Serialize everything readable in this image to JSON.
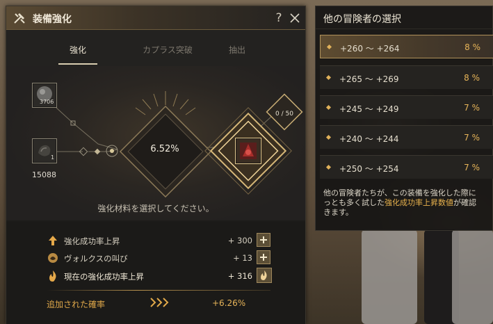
{
  "window": {
    "title": "装備強化",
    "help_label": "?"
  },
  "tabs": [
    {
      "label": "強化",
      "active": true
    },
    {
      "label": "カプラス突破",
      "active": false
    },
    {
      "label": "抽出",
      "active": false
    }
  ],
  "materials": {
    "stone": {
      "count_label": "15088",
      "slot_count": "3706"
    },
    "secondary": {
      "slot_count": "1"
    }
  },
  "success_rate": "6.52%",
  "cap_progress": "0 / 50",
  "instruction": "強化材料を選択してください。",
  "bonus_rows": [
    {
      "label": "強化成功率上昇",
      "value": "+ 300",
      "icon": "arrow-up-icon",
      "button": "plus"
    },
    {
      "label": "ヴォルクスの叫び",
      "value": "+ 13",
      "icon": "vorcus-icon",
      "button": "plus"
    },
    {
      "label": "現在の強化成功率上昇",
      "value": "+ 316",
      "icon": "flame-icon",
      "button": "flame"
    }
  ],
  "added": {
    "label": "追加された確率",
    "value": "+6.26%"
  },
  "side_panel": {
    "title": "他の冒険者の選択",
    "choices": [
      {
        "range": "+260 ～ +264",
        "percent": "8 %",
        "selected": true
      },
      {
        "range": "+265 ～ +269",
        "percent": "8 %",
        "selected": false
      },
      {
        "range": "+245 ～ +249",
        "percent": "7 %",
        "selected": false
      },
      {
        "range": "+240 ～ +244",
        "percent": "7 %",
        "selected": false
      },
      {
        "range": "+250 ～ +254",
        "percent": "7 %",
        "selected": false
      }
    ],
    "desc_part1": "他の冒険者たちが、この装備を強化した際に",
    "desc_part2": "っとも多く試した",
    "desc_highlight": "強化成功率上昇数値",
    "desc_part3": "が確認",
    "desc_part4": "きます。"
  },
  "colors": {
    "accent_gold": "#e7b458",
    "panel_bg": "#1d1c1a",
    "selected_row": "#5e4c31"
  }
}
